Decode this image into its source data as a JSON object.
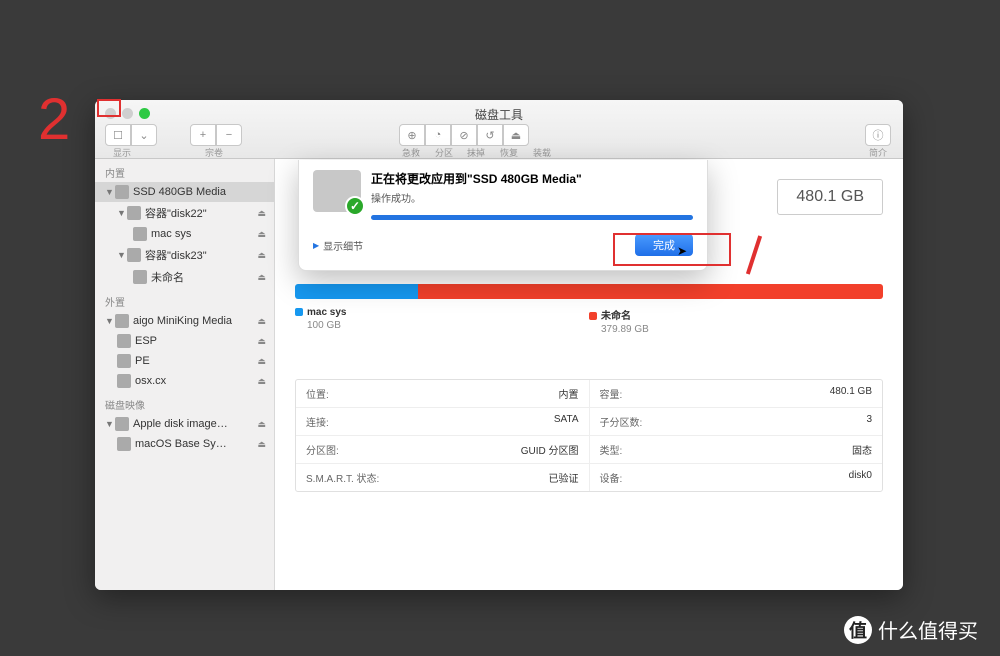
{
  "annotation": {
    "number": "2"
  },
  "window": {
    "title": "磁盘工具",
    "toolbar": {
      "view_label": "显示",
      "volume_label": "宗卷",
      "first_aid": "急救",
      "partition": "分区",
      "erase": "抹掉",
      "restore": "恢复",
      "unmount": "装载",
      "info": "简介"
    }
  },
  "sidebar": {
    "sections": {
      "internal": "内置",
      "external": "外置",
      "images": "磁盘映像"
    },
    "items": [
      {
        "label": "SSD 480GB Media",
        "level": 0,
        "selected": true,
        "eject": false
      },
      {
        "label": "容器\"disk22\"",
        "level": 1,
        "eject": true
      },
      {
        "label": "mac sys",
        "level": 2,
        "eject": true
      },
      {
        "label": "容器\"disk23\"",
        "level": 1,
        "eject": true
      },
      {
        "label": "未命名",
        "level": 2,
        "eject": true
      },
      {
        "label": "aigo MiniKing Media",
        "level": 0,
        "eject": true
      },
      {
        "label": "ESP",
        "level": 1,
        "eject": true
      },
      {
        "label": "PE",
        "level": 1,
        "eject": true
      },
      {
        "label": "osx.cx",
        "level": 1,
        "eject": true
      },
      {
        "label": "Apple disk image…",
        "level": 0,
        "eject": true
      },
      {
        "label": "macOS Base Sy…",
        "level": 1,
        "eject": true
      }
    ]
  },
  "main": {
    "capacity": "480.1 GB",
    "segments": [
      {
        "name": "mac sys",
        "size": "100 GB",
        "color": "#1698f0",
        "pct": 21
      },
      {
        "name": "未命名",
        "size": "379.89 GB",
        "color": "#f2402b",
        "pct": 79
      }
    ],
    "info": [
      {
        "k1": "位置:",
        "v1": "内置",
        "k2": "容量:",
        "v2": "480.1 GB"
      },
      {
        "k1": "连接:",
        "v1": "SATA",
        "k2": "子分区数:",
        "v2": "3"
      },
      {
        "k1": "分区图:",
        "v1": "GUID 分区图",
        "k2": "类型:",
        "v2": "固态"
      },
      {
        "k1": "S.M.A.R.T. 状态:",
        "v1": "已验证",
        "k2": "设备:",
        "v2": "disk0"
      }
    ]
  },
  "dialog": {
    "title": "正在将更改应用到\"SSD 480GB Media\"",
    "subtitle": "操作成功。",
    "details": "显示细节",
    "done": "完成"
  },
  "watermark": "什么值得买",
  "watermark_badge": "值"
}
